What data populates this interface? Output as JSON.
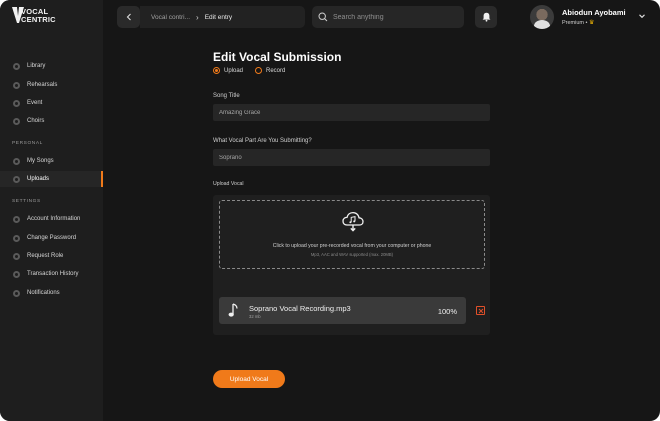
{
  "app": {
    "logo_text_line1": "VOCAL",
    "logo_text_line2": "CENTRIC"
  },
  "sidebar": {
    "main_items": [
      {
        "label": "Library",
        "icon": "library-icon"
      },
      {
        "label": "Rehearsals",
        "icon": "rehearsals-icon"
      },
      {
        "label": "Event",
        "icon": "event-icon"
      },
      {
        "label": "Choirs",
        "icon": "choirs-icon"
      }
    ],
    "personal_label": "PERSONAL",
    "personal_items": [
      {
        "label": "My Songs",
        "icon": "songs-icon",
        "active": false
      },
      {
        "label": "Uploads",
        "icon": "uploads-icon",
        "active": true
      }
    ],
    "settings_label": "SETTINGS",
    "settings_items": [
      {
        "label": "Account Information",
        "icon": "account-icon"
      },
      {
        "label": "Change Password",
        "icon": "password-icon"
      },
      {
        "label": "Request Role",
        "icon": "role-icon"
      },
      {
        "label": "Transaction History",
        "icon": "history-icon"
      },
      {
        "label": "Notifications",
        "icon": "notifications-icon"
      }
    ],
    "active_color": "#f07a1a"
  },
  "header": {
    "breadcrumb_parent": "Vocal contri...",
    "breadcrumb_current": "Edit entry",
    "search_placeholder": "Search anything",
    "user_name": "Abiodun Ayobami",
    "user_plan": "Premium •"
  },
  "form": {
    "title": "Edit Vocal Submission",
    "mode_options": [
      {
        "label": "Upload",
        "selected": true
      },
      {
        "label": "Record",
        "selected": false
      }
    ],
    "song_title_label": "Song Title",
    "song_title_value": "Amazing Grace",
    "vocal_part_label": "What Vocal Part Are You Submitting?",
    "vocal_part_value": "Soprano",
    "upload_label": "Upload Vocal",
    "dropzone_text": "Click to upload your pre-recorded vocal from your computer or phone",
    "dropzone_subtext": "Mp3, AAC and WAV supported (max. 20MB)",
    "file": {
      "name": "Soprano Vocal Recording.mp3",
      "size": "32 mb",
      "progress": "100%"
    },
    "submit_label": "Upload Vocal"
  },
  "colors": {
    "accent": "#f07a1a",
    "danger": "#e0502a"
  }
}
